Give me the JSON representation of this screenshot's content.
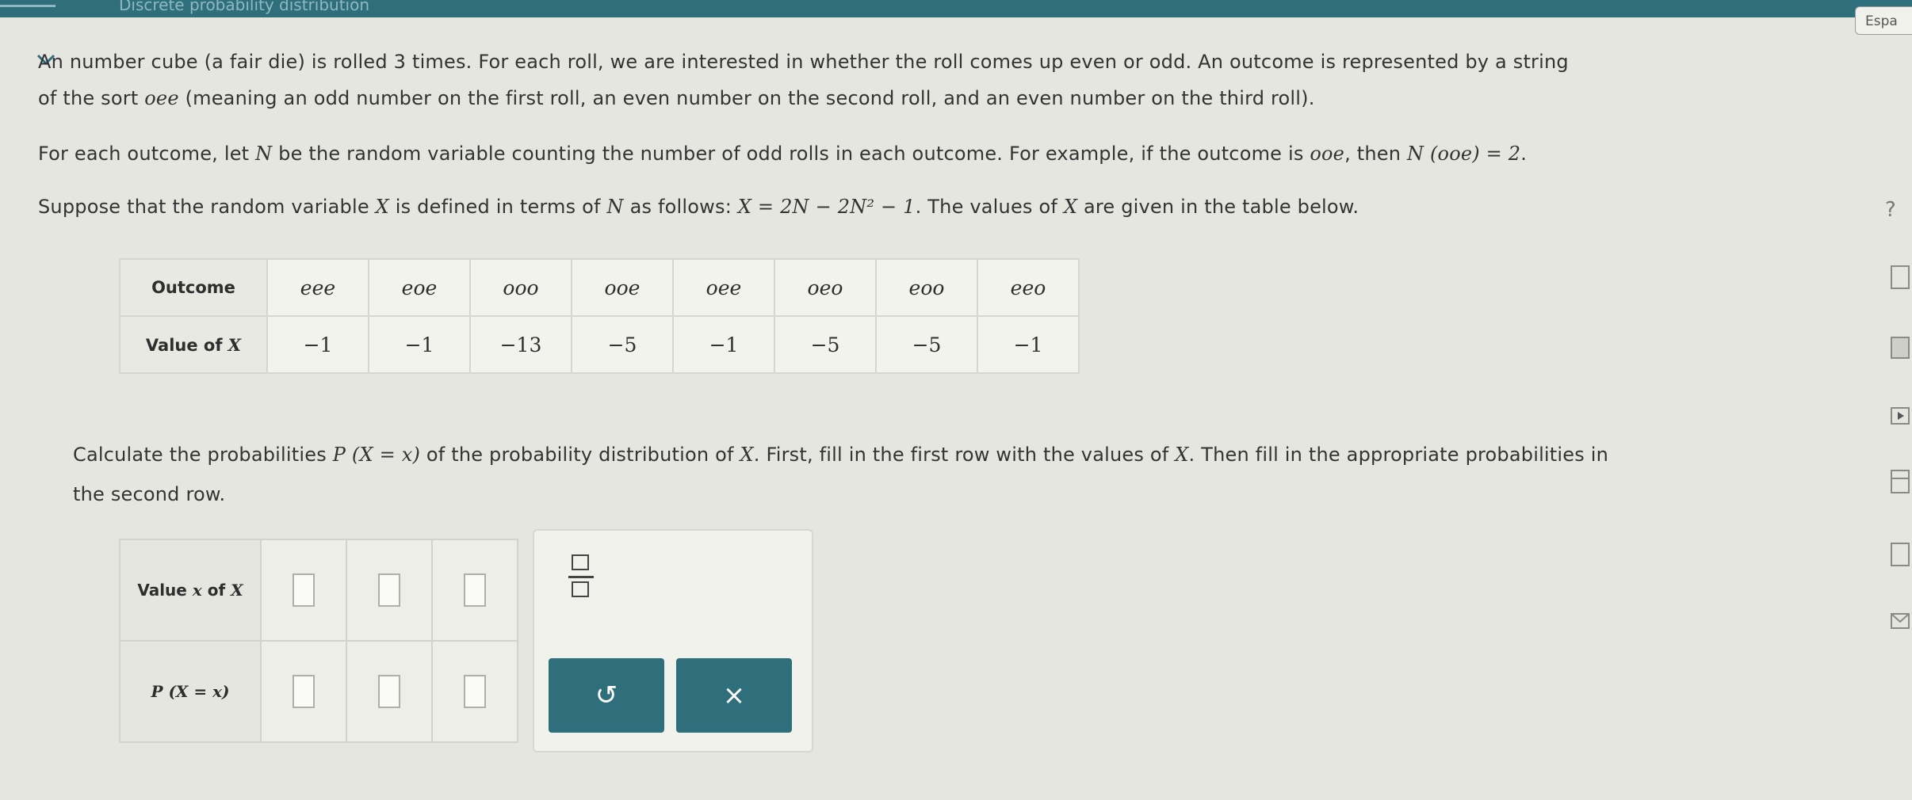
{
  "header": {
    "title": "Discrete probability distribution",
    "expand_label": "Espa"
  },
  "problem": {
    "p1_line1": "An number cube (a fair die) is rolled 3 times. For each roll, we are interested in whether the roll comes up even or odd. An outcome is represented by a string",
    "p1_line2_a": "of the sort ",
    "p1_line2_m": "oee",
    "p1_line2_b": " (meaning an odd number on the first roll, an even number on the second roll, and an even number on the third roll).",
    "p2_a": "For each outcome, let ",
    "p2_N": "N",
    "p2_b": " be the random variable counting the number of odd rolls in each outcome. For example, if the outcome is ",
    "p2_ooe": "ooe",
    "p2_c": ", then ",
    "p2_expr": "N (ooe) = 2",
    "p2_d": ".",
    "p3_a": "Suppose that the random variable ",
    "p3_X": "X",
    "p3_b": " is defined in terms of ",
    "p3_N": "N",
    "p3_c": " as follows: ",
    "p3_formula": "X = 2N − 2N² − 1",
    "p3_d": ". The values of ",
    "p3_X2": "X",
    "p3_e": " are given in the table below.",
    "p4_a": "Calculate the probabilities ",
    "p4_P": "P (X = x)",
    "p4_b": " of the probability distribution of ",
    "p4_X": "X",
    "p4_c": ". First, fill in the first row with the values of ",
    "p4_X2": "X",
    "p4_d": ". Then fill in the appropriate probabilities in",
    "p4_line2": "the second row."
  },
  "value_table": {
    "row1_label": "Outcome",
    "row2_label_a": "Value of ",
    "row2_label_X": "X",
    "outcomes": [
      "eee",
      "eoe",
      "ooo",
      "ooe",
      "oee",
      "oeo",
      "eoo",
      "eeo"
    ],
    "values": [
      "−1",
      "−1",
      "−13",
      "−5",
      "−1",
      "−5",
      "−5",
      "−1"
    ]
  },
  "answer_table": {
    "row1_label_a": "Value ",
    "row1_label_x": "x",
    "row1_label_b": " of ",
    "row1_label_X": "X",
    "row2_label": "P (X = x)",
    "columns": 3
  },
  "tools": {
    "fraction_icon": "fraction-icon",
    "undo_symbol": "↺",
    "clear_symbol": "×"
  },
  "side_rail": {
    "help_symbol": "?"
  },
  "colors": {
    "accent": "#2f6f7c",
    "background": "#e6e6e0"
  }
}
